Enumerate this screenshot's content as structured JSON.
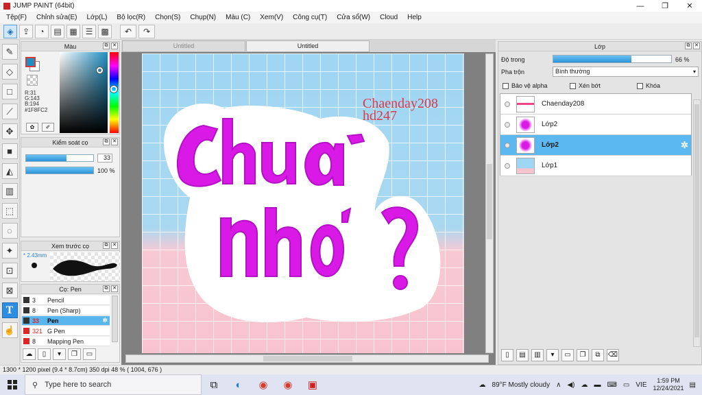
{
  "window": {
    "title": "JUMP PAINT (64bit)",
    "minimize": "—",
    "maximize": "❐",
    "close": "✕"
  },
  "menu": [
    "Tệp(F)",
    "Chỉnh sửa(E)",
    "Lớp(L)",
    "Bộ lọc(R)",
    "Chọn(S)",
    "Chụp(N)",
    "Màu (C)",
    "Xem(V)",
    "Công cụ(T)",
    "Cửa sổ(W)",
    "Cloud",
    "Help"
  ],
  "color_panel": {
    "title": "Màu",
    "r": "R:31",
    "g": "G:143",
    "b": "B:194",
    "hex": "#1F8FC2",
    "main_color": "#1f8fc2"
  },
  "brush_control": {
    "title": "Kiểm soát cọ",
    "size": "33",
    "size_fraction": 0.6,
    "opacity": "100 %",
    "opacity_fraction": 1.0
  },
  "brush_preview": {
    "title": "Xem trước cọ",
    "size_label": "* 2.43mm"
  },
  "brush_list": {
    "title": "Cọ: Pen",
    "items": [
      {
        "size": "3",
        "name": "Pencil",
        "color": "#333333"
      },
      {
        "size": "8",
        "name": "Pen (Sharp)",
        "color": "#333333"
      },
      {
        "size": "33",
        "name": "Pen",
        "color": "#333333",
        "selected": true
      },
      {
        "size": "321",
        "name": "G Pen",
        "color": "#e02525"
      },
      {
        "size": "8",
        "name": "Mapping Pen",
        "color": "#e02525"
      }
    ]
  },
  "tabs": [
    "Untitled",
    "Untitled"
  ],
  "artwork": {
    "signature_line1": "Chaenday208",
    "signature_line2": "hd247"
  },
  "layer_panel": {
    "title": "Lớp",
    "opacity_label": "Độ trong",
    "opacity_value": "66 %",
    "opacity_fraction": 0.66,
    "blend_label": "Pha trộn",
    "blend_value": "Bình thường",
    "protect_alpha": "Bảo vệ alpha",
    "clipping": "Xén bớt",
    "lock": "Khóa",
    "layers": [
      {
        "name": "Chaenday208",
        "selected": false
      },
      {
        "name": "Lớp2",
        "selected": false
      },
      {
        "name": "Lớp2",
        "selected": true
      },
      {
        "name": "Lớp1",
        "selected": false
      }
    ]
  },
  "status": {
    "text": "1300 * 1200 pixel  (9.4 * 8.7cm)  350 dpi  48 %  ( 1004, 676 )"
  },
  "taskbar": {
    "search_placeholder": "Type here to search",
    "weather": "89°F  Mostly cloudy",
    "lang": "VIE",
    "time": "1:59 PM",
    "date": "12/24/2021"
  }
}
